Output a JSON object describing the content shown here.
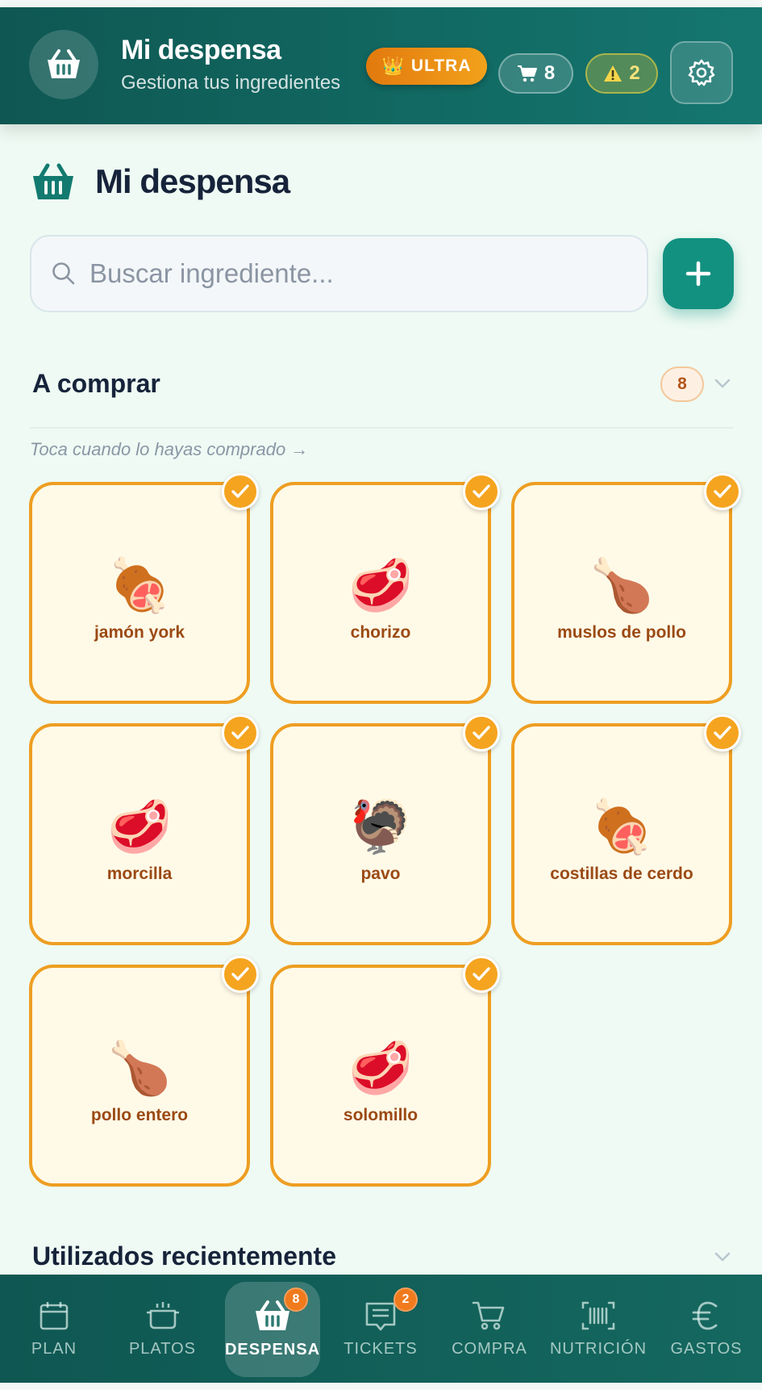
{
  "header": {
    "title": "Mi despensa",
    "subtitle": "Gestiona tus ingredientes",
    "ultra_label": "ULTRA",
    "cart_count": "8",
    "warning_count": "2"
  },
  "page": {
    "title": "Mi despensa"
  },
  "search": {
    "placeholder": "Buscar ingrediente..."
  },
  "to_buy": {
    "title": "A comprar",
    "count": "8",
    "hint": "Toca cuando lo hayas comprado →",
    "items": [
      {
        "name": "jamón york",
        "icon": "🍖"
      },
      {
        "name": "chorizo",
        "icon": "🥩"
      },
      {
        "name": "muslos de pollo",
        "icon": "🍗"
      },
      {
        "name": "morcilla",
        "icon": "🥩"
      },
      {
        "name": "pavo",
        "icon": "🦃"
      },
      {
        "name": "costillas de cerdo",
        "icon": "🍖"
      },
      {
        "name": "pollo entero",
        "icon": "🍗"
      },
      {
        "name": "solomillo",
        "icon": "🥩"
      }
    ]
  },
  "recent": {
    "title": "Utilizados recientemente"
  },
  "nav": {
    "items": [
      {
        "label": "PLAN",
        "icon": "calendar-icon"
      },
      {
        "label": "PLATOS",
        "icon": "pot-icon"
      },
      {
        "label": "DESPENSA",
        "icon": "basket-icon",
        "badge": "8",
        "active": true
      },
      {
        "label": "TICKETS",
        "icon": "receipt-icon",
        "badge": "2"
      },
      {
        "label": "COMPRA",
        "icon": "cart-icon"
      },
      {
        "label": "NUTRICIÓN",
        "icon": "barcode-icon"
      },
      {
        "label": "GASTOS",
        "icon": "euro-icon"
      }
    ]
  },
  "colors": {
    "header_bg": "#0f5752",
    "accent": "#139180",
    "card_border": "#ee9e22",
    "card_bg": "#fffae8"
  }
}
